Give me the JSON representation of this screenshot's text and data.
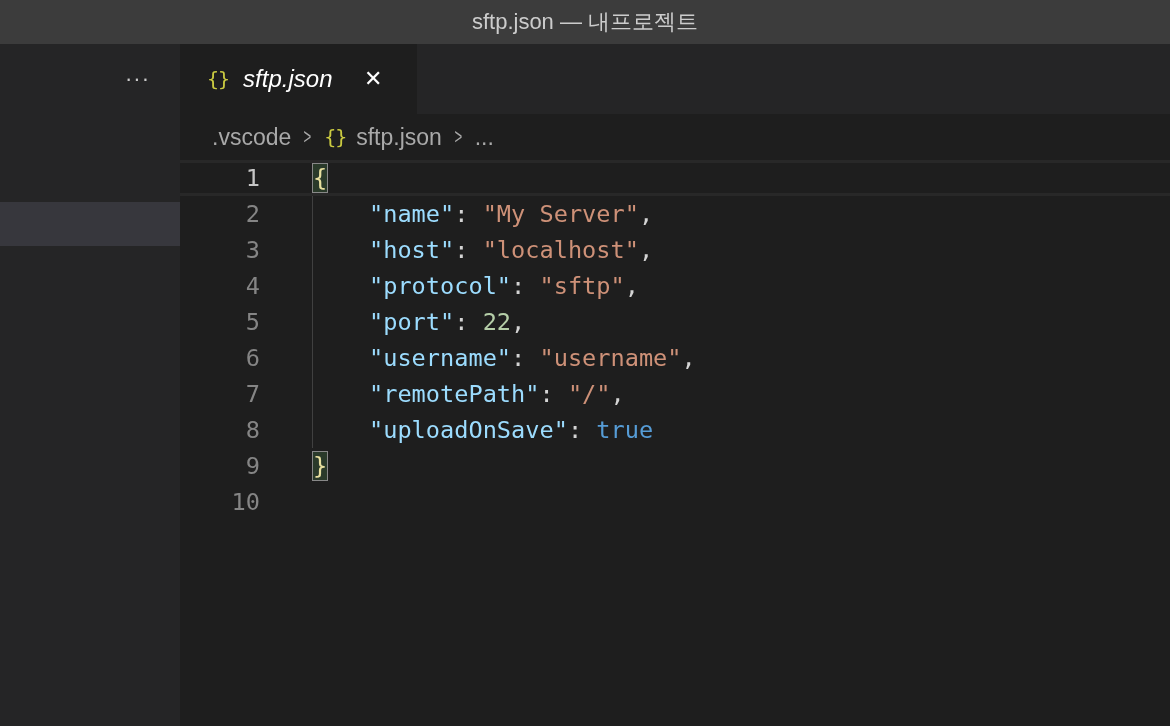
{
  "window": {
    "title": "sftp.json — 내프로젝트"
  },
  "sidebar": {
    "more": "···",
    "items": [
      {
        "selected": true
      }
    ]
  },
  "tabs": [
    {
      "label": "sftp.json",
      "icon": "{}",
      "selected": true,
      "italic": true,
      "close": "✕"
    }
  ],
  "breadcrumb": [
    {
      "label": ".vscode"
    },
    {
      "icon": "{}",
      "label": "sftp.json"
    },
    {
      "label": "..."
    }
  ],
  "breadcrumb_separator": ">",
  "lines": [
    {
      "number": "1",
      "active": true,
      "indent": false,
      "tokens": [
        {
          "kind": "bracket",
          "text": "{",
          "matched": true
        }
      ]
    },
    {
      "number": "2",
      "active": false,
      "indent": true,
      "tokens": [
        {
          "kind": "key",
          "text": "\"name\""
        },
        {
          "kind": "punct",
          "text": ": "
        },
        {
          "kind": "string",
          "text": "\"My Server\""
        },
        {
          "kind": "punct",
          "text": ","
        }
      ]
    },
    {
      "number": "3",
      "active": false,
      "indent": true,
      "tokens": [
        {
          "kind": "key",
          "text": "\"host\""
        },
        {
          "kind": "punct",
          "text": ": "
        },
        {
          "kind": "string",
          "text": "\"localhost\""
        },
        {
          "kind": "punct",
          "text": ","
        }
      ]
    },
    {
      "number": "4",
      "active": false,
      "indent": true,
      "tokens": [
        {
          "kind": "key",
          "text": "\"protocol\""
        },
        {
          "kind": "punct",
          "text": ": "
        },
        {
          "kind": "string",
          "text": "\"sftp\""
        },
        {
          "kind": "punct",
          "text": ","
        }
      ]
    },
    {
      "number": "5",
      "active": false,
      "indent": true,
      "tokens": [
        {
          "kind": "key",
          "text": "\"port\""
        },
        {
          "kind": "punct",
          "text": ": "
        },
        {
          "kind": "number",
          "text": "22"
        },
        {
          "kind": "punct",
          "text": ","
        }
      ]
    },
    {
      "number": "6",
      "active": false,
      "indent": true,
      "tokens": [
        {
          "kind": "key",
          "text": "\"username\""
        },
        {
          "kind": "punct",
          "text": ": "
        },
        {
          "kind": "string",
          "text": "\"username\""
        },
        {
          "kind": "punct",
          "text": ","
        }
      ]
    },
    {
      "number": "7",
      "active": false,
      "indent": true,
      "tokens": [
        {
          "kind": "key",
          "text": "\"remotePath\""
        },
        {
          "kind": "punct",
          "text": ": "
        },
        {
          "kind": "string",
          "text": "\"/\""
        },
        {
          "kind": "punct",
          "text": ","
        }
      ]
    },
    {
      "number": "8",
      "active": false,
      "indent": true,
      "tokens": [
        {
          "kind": "key",
          "text": "\"uploadOnSave\""
        },
        {
          "kind": "punct",
          "text": ": "
        },
        {
          "kind": "keyword",
          "text": "true"
        }
      ]
    },
    {
      "number": "9",
      "active": false,
      "indent": false,
      "tokens": [
        {
          "kind": "bracket",
          "text": "}",
          "matched": true
        }
      ]
    },
    {
      "number": "10",
      "active": false,
      "indent": false
    }
  ]
}
